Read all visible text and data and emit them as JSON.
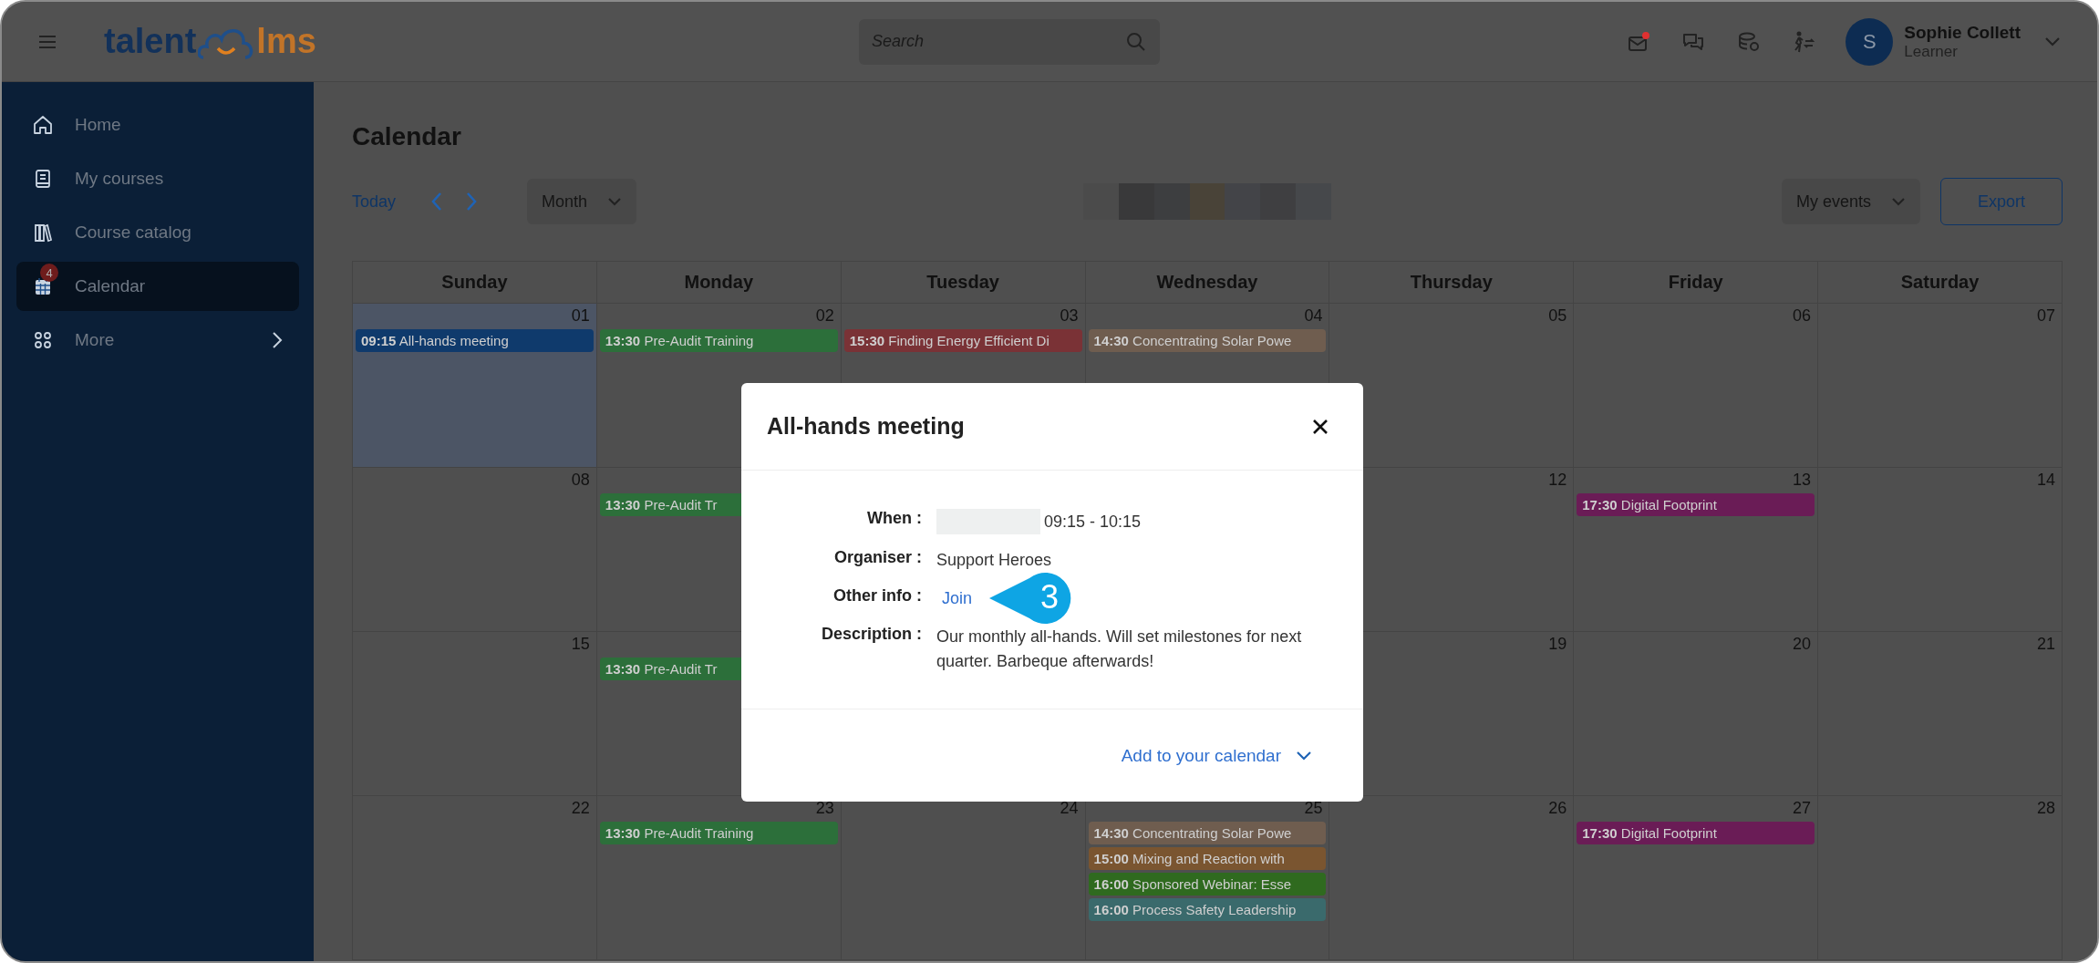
{
  "topbar": {
    "logo": {
      "left": "talent",
      "right": "lms"
    },
    "search": {
      "placeholder": "Search"
    },
    "user": {
      "initial": "S",
      "name": "Sophie Collett",
      "role": "Learner"
    }
  },
  "sidebar": {
    "items": [
      {
        "kind": "home",
        "label": "Home",
        "selected": false
      },
      {
        "kind": "courses",
        "label": "My courses",
        "selected": false
      },
      {
        "kind": "catalog",
        "label": "Course catalog",
        "selected": false
      },
      {
        "kind": "calendar",
        "label": "Calendar",
        "selected": true,
        "badge": "4"
      },
      {
        "kind": "more",
        "label": "More",
        "selected": false
      }
    ]
  },
  "page": {
    "title": "Calendar"
  },
  "toolbar": {
    "today": "Today",
    "view": "Month",
    "filter": "My events",
    "export": "Export"
  },
  "calendar": {
    "weekdays": [
      "Sunday",
      "Monday",
      "Tuesday",
      "Wednesday",
      "Thursday",
      "Friday",
      "Saturday"
    ],
    "weeks": [
      {
        "days": [
          {
            "kind": "day",
            "date": "01",
            "selected": true,
            "events": [
              {
                "time": "09:15",
                "title": "All-hands meeting",
                "color": "#0f3a6c"
              }
            ]
          },
          {
            "kind": "day",
            "date": "02",
            "selected": false,
            "events": [
              {
                "time": "13:30",
                "title": "Pre-Audit Training",
                "color": "#2c6f3a"
              }
            ]
          },
          {
            "kind": "day",
            "date": "03",
            "selected": false,
            "events": [
              {
                "time": "15:30",
                "title": "Finding Energy Efficient Di",
                "color": "#7a3236"
              }
            ]
          },
          {
            "kind": "day",
            "date": "04",
            "selected": false,
            "events": [
              {
                "time": "14:30",
                "title": "Concentrating Solar Powe",
                "color": "#6f5d4f"
              }
            ]
          },
          {
            "kind": "day",
            "date": "05",
            "selected": false
          },
          {
            "kind": "day",
            "date": "06",
            "selected": false
          },
          {
            "kind": "day",
            "date": "07",
            "selected": false
          }
        ]
      },
      {
        "days": [
          {
            "kind": "day",
            "date": "08",
            "selected": false
          },
          {
            "kind": "day",
            "selected": false,
            "events": [
              {
                "time": "13:30",
                "title": "Pre-Audit Tr",
                "color": "#2c6f3a"
              }
            ]
          },
          {
            "kind": "covered"
          },
          {
            "kind": "covered"
          },
          {
            "kind": "day",
            "date": "12",
            "selected": false
          },
          {
            "kind": "day",
            "date": "13",
            "selected": false,
            "events": [
              {
                "time": "17:30",
                "title": "Digital Footprint",
                "color": "#6a1c56"
              }
            ]
          },
          {
            "kind": "day",
            "date": "14",
            "selected": false
          }
        ]
      },
      {
        "days": [
          {
            "kind": "day",
            "date": "15",
            "selected": false
          },
          {
            "kind": "day",
            "selected": false,
            "events": [
              {
                "time": "13:30",
                "title": "Pre-Audit Tr",
                "color": "#2c6f3a"
              }
            ]
          },
          {
            "kind": "covered"
          },
          {
            "kind": "covered"
          },
          {
            "kind": "day",
            "date": "19",
            "selected": false
          },
          {
            "kind": "day",
            "date": "20",
            "selected": false
          },
          {
            "kind": "day",
            "date": "21",
            "selected": false
          }
        ]
      },
      {
        "days": [
          {
            "kind": "day",
            "date": "22",
            "selected": false
          },
          {
            "kind": "day",
            "date": "23",
            "selected": false,
            "events": [
              {
                "time": "13:30",
                "title": "Pre-Audit Training",
                "color": "#2c6f3a"
              }
            ]
          },
          {
            "kind": "day",
            "date": "24",
            "selected": false
          },
          {
            "kind": "day",
            "date": "25",
            "selected": false,
            "events": [
              {
                "time": "14:30",
                "title": "Concentrating Solar Powe",
                "color": "#6f5d4f"
              },
              {
                "time": "15:00",
                "title": "Mixing and Reaction with",
                "color": "#7a5530"
              },
              {
                "time": "16:00",
                "title": "Sponsored Webinar: Esse",
                "color": "#2f6a1f"
              },
              {
                "time": "16:00",
                "title": "Process Safety Leadership",
                "color": "#3a6a6c"
              }
            ]
          },
          {
            "kind": "day",
            "date": "26",
            "selected": false
          },
          {
            "kind": "day",
            "date": "27",
            "selected": false,
            "events": [
              {
                "time": "17:30",
                "title": "Digital Footprint",
                "color": "#6a1c56"
              }
            ]
          },
          {
            "kind": "day",
            "date": "28",
            "selected": false
          }
        ]
      }
    ]
  },
  "modal": {
    "title": "All-hands meeting",
    "fields": [
      {
        "kind": "time",
        "label": "When :",
        "value": "09:15 - 10:15"
      },
      {
        "kind": "text",
        "label": "Organiser :",
        "value": "Support Heroes"
      },
      {
        "kind": "link",
        "label": "Other info :",
        "value": "Join"
      },
      {
        "kind": "text",
        "label": "Description :",
        "value": "Our monthly all-hands. Will set milestones for next quarter. Barbeque afterwards!"
      }
    ],
    "footer": "Add to your calendar"
  },
  "callout": {
    "label": "3"
  }
}
